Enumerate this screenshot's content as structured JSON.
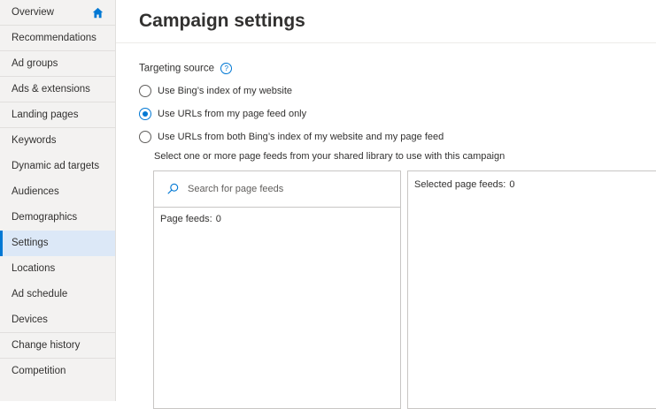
{
  "sidebar": {
    "items": [
      {
        "label": "Overview"
      },
      {
        "label": "Recommendations"
      },
      {
        "label": "Ad groups"
      },
      {
        "label": "Ads & extensions"
      },
      {
        "label": "Landing pages"
      },
      {
        "label": "Keywords"
      },
      {
        "label": "Dynamic ad targets"
      },
      {
        "label": "Audiences"
      },
      {
        "label": "Demographics"
      },
      {
        "label": "Settings"
      },
      {
        "label": "Locations"
      },
      {
        "label": "Ad schedule"
      },
      {
        "label": "Devices"
      },
      {
        "label": "Change history"
      },
      {
        "label": "Competition"
      }
    ],
    "active_item": "Settings"
  },
  "header": {
    "title": "Campaign settings"
  },
  "targeting": {
    "label": "Targeting source",
    "help_glyph": "?",
    "options": [
      {
        "label": "Use Bing’s index of my website",
        "checked": false
      },
      {
        "label": "Use URLs from my page feed only",
        "checked": true
      },
      {
        "label": "Use URLs from both Bing’s index of my website and my page feed",
        "checked": false
      }
    ],
    "instruction": "Select one or more page feeds from your shared library to use with this campaign"
  },
  "feeds": {
    "search_placeholder": "Search for page feeds",
    "page_feeds_label": "Page feeds:",
    "page_feeds_count": "0",
    "selected_label": "Selected page feeds:",
    "selected_count": "0"
  },
  "colors": {
    "accent": "#0078d4",
    "sidebar_bg": "#f3f2f1",
    "active_bg": "#dce8f7"
  },
  "icons": {
    "home": "home-icon",
    "search": "search-icon",
    "help": "help-icon"
  }
}
